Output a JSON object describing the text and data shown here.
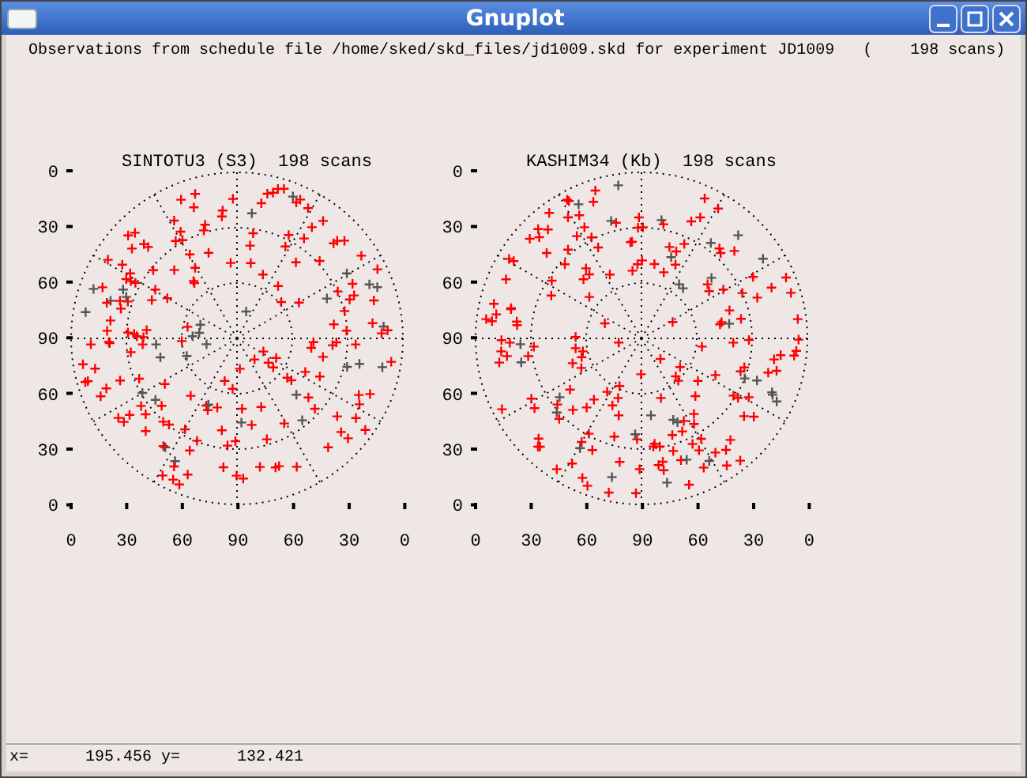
{
  "window": {
    "title": "Gnuplot"
  },
  "header": "Observations from schedule file /home/sked/skd_files/jd1009.skd for experiment JD1009   (    198 scans)",
  "plots": [
    {
      "title": "SINTOTU3 (S3)  198 scans",
      "y_ticks": [
        "0",
        "30",
        "60",
        "90",
        "60",
        "30",
        "0"
      ],
      "x_ticks": [
        "0",
        "30",
        "60",
        "90",
        "60",
        "30",
        "0"
      ]
    },
    {
      "title": "KASHIM34 (Kb)  198 scans",
      "y_ticks": [
        "0",
        "30",
        "60",
        "90",
        "60",
        "30",
        "0"
      ],
      "x_ticks": [
        "0",
        "30",
        "60",
        "90",
        "60",
        "30",
        "0"
      ]
    }
  ],
  "status_bar": "x=      195.456 y=      132.421"
}
